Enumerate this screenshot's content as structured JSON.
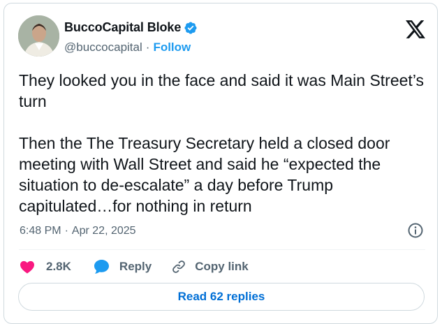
{
  "author": {
    "display_name": "BuccoCapital Bloke",
    "handle": "@buccocapital",
    "separator": "·",
    "follow_label": "Follow",
    "verified_color": "#1d9bf0"
  },
  "tweet": {
    "paragraphs": [
      "They looked you in the face and said it was Main Street’s turn",
      "Then the The Treasury Secretary held a closed door meeting with Wall Street and said he “expected the situation to de-escalate” a day before Trump capitulated…for nothing in return"
    ],
    "time": "6:48 PM",
    "meta_separator": "·",
    "date": "Apr 22, 2025"
  },
  "actions": {
    "like_count": "2.8K",
    "reply_label": "Reply",
    "copy_link_label": "Copy link"
  },
  "read_replies_label": "Read 62 replies",
  "icons": {
    "like": "heart-icon",
    "reply": "speech-bubble-icon",
    "copy": "link-icon",
    "info": "info-icon",
    "brand": "x-logo-icon",
    "verified": "verified-badge-icon"
  },
  "colors": {
    "like": "#f91880",
    "reply": "#1d9bf0",
    "link_text": "#006fd6",
    "muted": "#536471"
  }
}
